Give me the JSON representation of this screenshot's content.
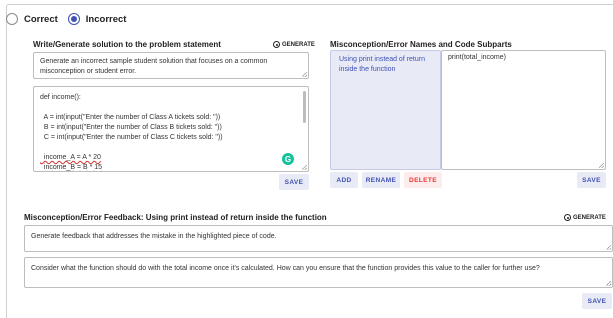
{
  "answer_type": {
    "options": [
      {
        "label": "Correct",
        "checked": false
      },
      {
        "label": "Incorrect",
        "checked": true
      }
    ]
  },
  "solution_panel": {
    "title": "Write/Generate solution to the problem statement",
    "generate_label": "GENERATE",
    "prompt_text": "Generate an incorrect sample student solution that focuses on a common misconception or student error.",
    "code_lines": [
      "def income():",
      "",
      "  A = int(input(\"Enter the number of Class A tickets sold: \"))",
      "  B = int(input(\"Enter the number of Class B tickets sold: \"))",
      "  C = int(input(\"Enter the number of Class C tickets sold: \"))",
      "",
      "  income_A = A * 20",
      "  income_B = B * 15"
    ],
    "save_label": "SAVE"
  },
  "misconception_panel": {
    "title": "Misconception/Error Names and Code Subparts",
    "items": [
      "Using print instead of return inside the function"
    ],
    "code_subpart": "print(total_income)",
    "add_label": "ADD",
    "rename_label": "RENAME",
    "delete_label": "DELETE",
    "save_label": "SAVE"
  },
  "feedback_panel": {
    "title": "Misconception/Error Feedback: Using print instead of return inside the function",
    "generate_label": "GENERATE",
    "prompt_text": "Generate feedback that addresses the mistake in the highlighted piece of code.",
    "feedback_text": "Consider what the function should do with the total income once it's calculated. How can you ensure that the function provides this value to the caller for further use?",
    "save_label": "SAVE"
  },
  "colors": {
    "accent": "#3f51b5",
    "accent_bg": "#e8eaf6",
    "danger": "#e53935",
    "danger_bg": "#fdecec",
    "grammarly": "#15c39a"
  }
}
